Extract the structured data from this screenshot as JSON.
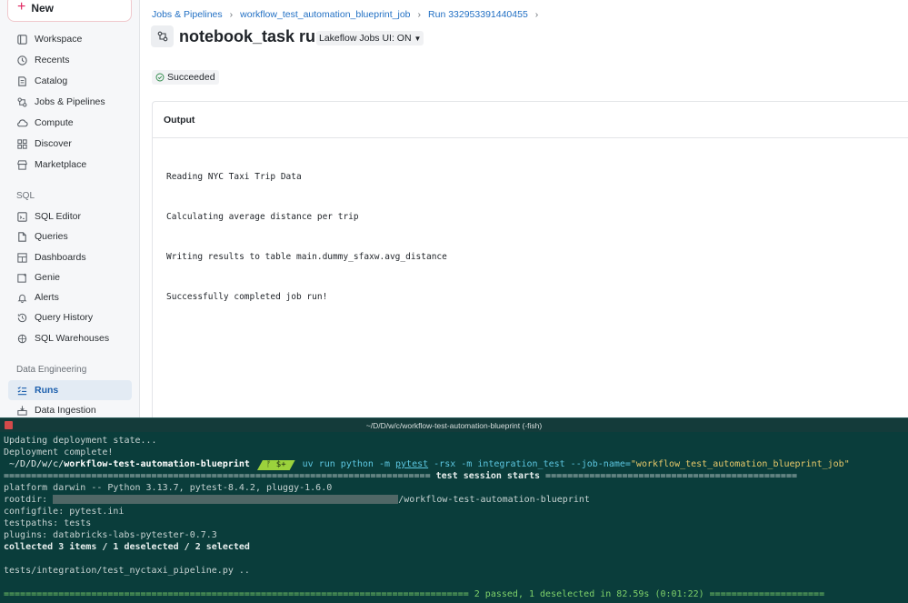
{
  "sidebar": {
    "new_label": "New",
    "items": [
      {
        "key": "workspace",
        "label": "Workspace",
        "icon": "workspace-icon"
      },
      {
        "key": "recents",
        "label": "Recents",
        "icon": "clock-icon"
      },
      {
        "key": "catalog",
        "label": "Catalog",
        "icon": "catalog-icon"
      },
      {
        "key": "jobs",
        "label": "Jobs & Pipelines",
        "icon": "jobs-icon"
      },
      {
        "key": "compute",
        "label": "Compute",
        "icon": "cloud-icon"
      },
      {
        "key": "discover",
        "label": "Discover",
        "icon": "grid-icon"
      },
      {
        "key": "marketplace",
        "label": "Marketplace",
        "icon": "store-icon"
      }
    ],
    "sql_section": "SQL",
    "sql_items": [
      {
        "key": "sql-editor",
        "label": "SQL Editor",
        "icon": "editor-icon"
      },
      {
        "key": "queries",
        "label": "Queries",
        "icon": "document-icon"
      },
      {
        "key": "dashboards",
        "label": "Dashboards",
        "icon": "dashboard-icon"
      },
      {
        "key": "genie",
        "label": "Genie",
        "icon": "genie-icon"
      },
      {
        "key": "alerts",
        "label": "Alerts",
        "icon": "bell-icon"
      },
      {
        "key": "query-history",
        "label": "Query History",
        "icon": "history-icon"
      },
      {
        "key": "sql-warehouses",
        "label": "SQL Warehouses",
        "icon": "warehouse-icon"
      }
    ],
    "de_section": "Data Engineering",
    "de_items": [
      {
        "key": "runs",
        "label": "Runs",
        "icon": "runs-icon",
        "active": true
      },
      {
        "key": "data-ingestion",
        "label": "Data Ingestion",
        "icon": "ingestion-icon"
      }
    ]
  },
  "main": {
    "breadcrumb": [
      "Jobs & Pipelines",
      "workflow_test_automation_blueprint_job",
      "Run 332953391440455"
    ],
    "title": "notebook_task run",
    "lakeflow_toggle": "Lakeflow Jobs UI: ON",
    "status": "Succeeded",
    "output_title": "Output",
    "output_lines": [
      "Reading NYC Taxi Trip Data",
      "Calculating average distance per trip",
      "Writing results to table main.dummy_sfaxw.avg_distance",
      "Successfully completed job run!"
    ]
  },
  "terminal": {
    "title": "~/D/D/w/c/workflow-test-automation-blueprint (-fish)",
    "line1": "Updating deployment state...",
    "line2": "Deployment complete!",
    "prompt_path": " ~/D/D/w/c/",
    "prompt_dir": "workflow-test-automation-blueprint",
    "git_segment": "ᚠ $+",
    "cmd_prefix": "uv run python -m ",
    "cmd_pytest": "pytest",
    "cmd_flags": " -rsx -m integration_test --job-name=",
    "cmd_jobname": "\"workflow_test_automation_blueprint_job\"",
    "session_start": " test session starts ",
    "platform": "platform darwin -- Python 3.13.7, pytest-8.4.2, pluggy-1.6.0",
    "rootdir_prefix": "rootdir: ",
    "rootdir_suffix": "/workflow-test-automation-blueprint",
    "configfile": "configfile: pytest.ini",
    "testpaths": "testpaths: tests",
    "plugins": "plugins: databricks-labs-pytester-0.7.3",
    "collected": "collected 3 items / 1 deselected / 2 selected",
    "test_file": "tests/integration/test_nyctaxi_pipeline.py ..",
    "summary_passed": "2 passed",
    "summary_rest": ", 1 deselected in 82.59s (0:01:22) "
  }
}
